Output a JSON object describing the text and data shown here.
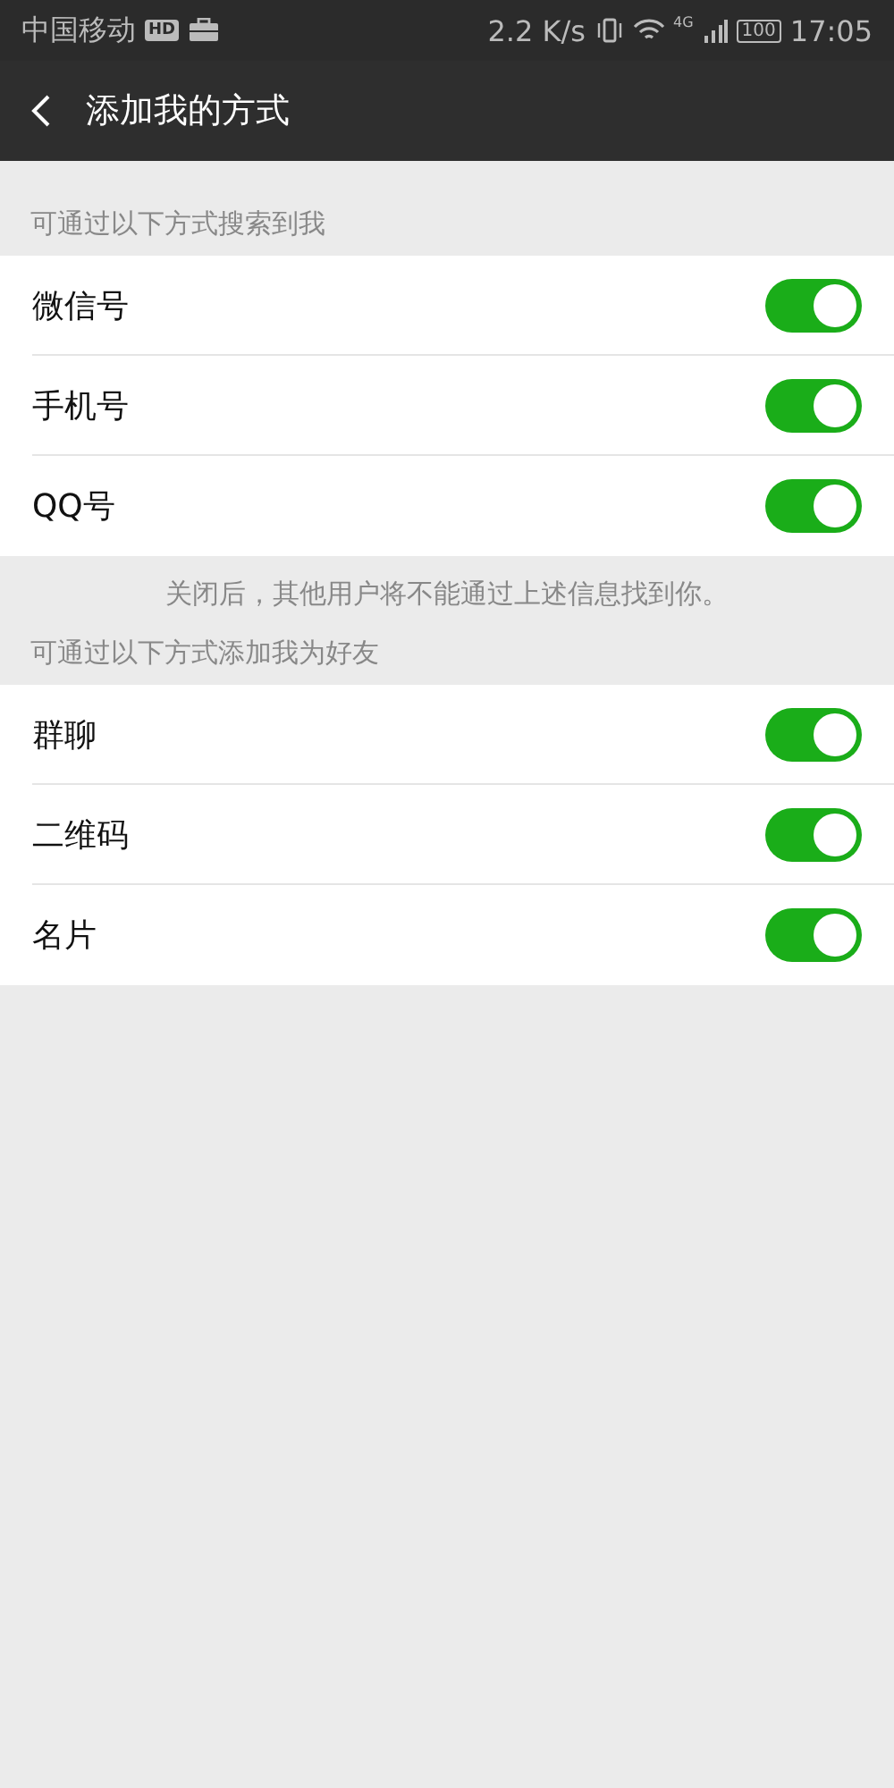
{
  "status_bar": {
    "carrier": "中国移动",
    "hd_badge": "HD",
    "speed": "2.2 K/s",
    "network": "4G",
    "battery": "100",
    "time": "17:05"
  },
  "nav": {
    "title": "添加我的方式"
  },
  "sections": [
    {
      "header": "可通过以下方式搜索到我",
      "items": [
        {
          "label": "微信号",
          "on": true
        },
        {
          "label": "手机号",
          "on": true
        },
        {
          "label": "QQ号",
          "on": true
        }
      ],
      "note": "关闭后，其他用户将不能通过上述信息找到你。"
    },
    {
      "header": "可通过以下方式添加我为好友",
      "items": [
        {
          "label": "群聊",
          "on": true
        },
        {
          "label": "二维码",
          "on": true
        },
        {
          "label": "名片",
          "on": true
        }
      ]
    }
  ]
}
